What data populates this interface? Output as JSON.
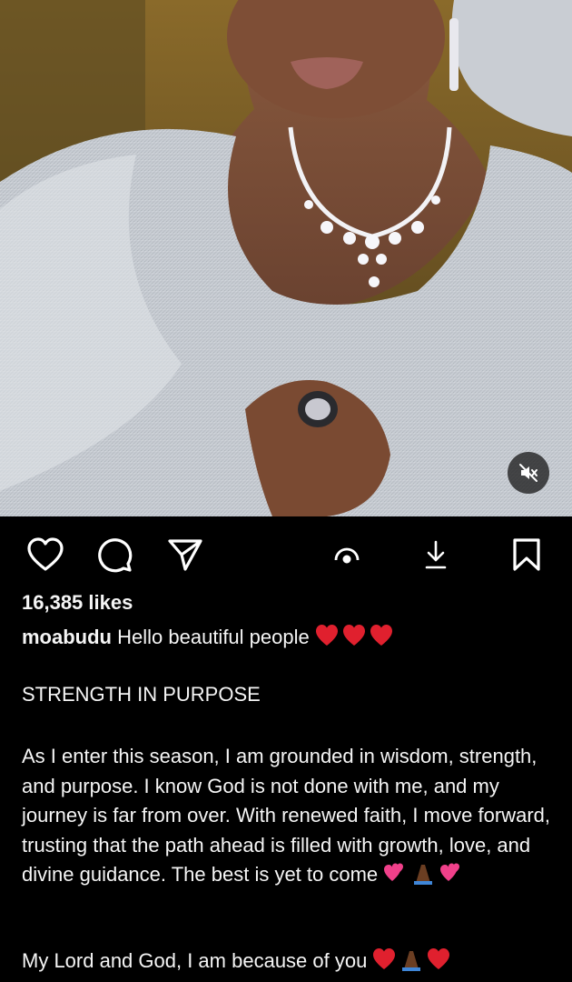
{
  "post": {
    "media": {
      "alt_subject": "woman in silver lace outfit with diamond necklace",
      "mute_icon": "speaker-muted-icon"
    },
    "actions": {
      "like_icon": "heart-icon",
      "comment_icon": "comment-icon",
      "share_icon": "send-icon",
      "carousel_icon": "carousel-dots-icon",
      "download_icon": "download-icon",
      "save_icon": "bookmark-icon"
    },
    "likes_text": "16,385 likes",
    "caption": {
      "username": "moabudu",
      "first_line": "Hello beautiful people",
      "first_line_emojis": "❤️❤️❤️",
      "heading": "STRENGTH IN PURPOSE",
      "body": "As I enter this season, I am grounded in wisdom, strength, and purpose. I know God is not done with me, and my journey is far from over. With renewed faith, I move forward, trusting that the path ahead is filled with growth, love, and divine guidance. The best is yet to come",
      "body_emojis": "💕🙏🏾💕",
      "closing": "My Lord and God, I am because of you",
      "closing_emojis": "❤️🙏🏾❤️"
    },
    "colors": {
      "background": "#000000",
      "text": "#f5f5f5",
      "heart_red": "#e0202e",
      "pink": "#f0408a"
    }
  }
}
